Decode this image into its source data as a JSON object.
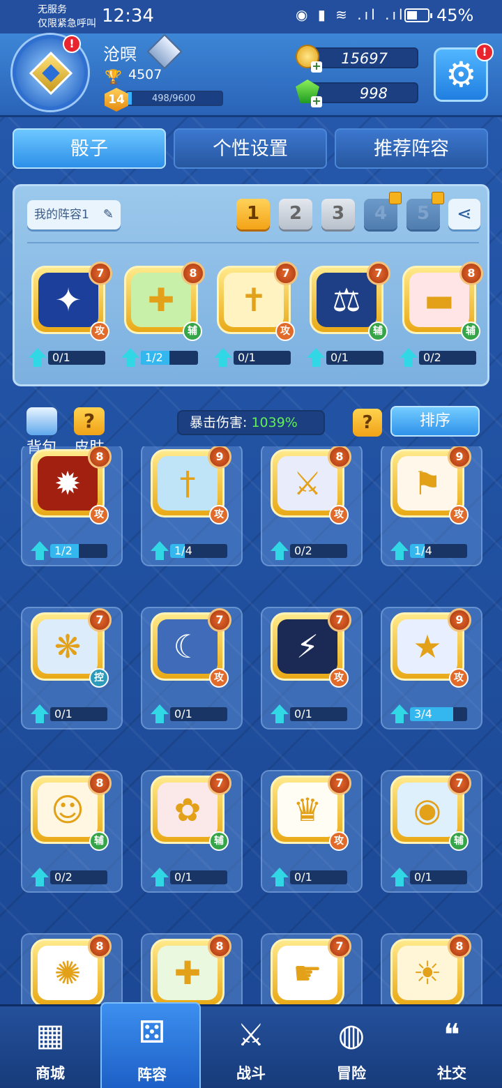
{
  "status_bar": {
    "carrier_line1": "无服务",
    "carrier_line2": "仅限紧急呼叫",
    "time": "12:34",
    "icons": "◉ ▮ ≋ .ıl .ıl",
    "battery": "45%"
  },
  "player": {
    "name": "沧暝",
    "trophies": "4507",
    "level": "14",
    "xp_text": "498/9600",
    "xp_progress": 0.052,
    "gold": "15697",
    "gems": "998"
  },
  "tabs": [
    {
      "label": "骰子",
      "active": true
    },
    {
      "label": "个性设置",
      "active": false
    },
    {
      "label": "推荐阵容",
      "active": false
    }
  ],
  "lineup": {
    "name": "我的阵容1",
    "edit_icon": "pencil-icon",
    "slots": [
      {
        "label": "1",
        "state": "on"
      },
      {
        "label": "2",
        "state": "off"
      },
      {
        "label": "3",
        "state": "off"
      },
      {
        "label": "4",
        "state": "lock"
      },
      {
        "label": "5",
        "state": "lock"
      }
    ],
    "share_icon": "share-icon",
    "dice": [
      {
        "level": "7",
        "role": "攻",
        "progress": "0/1",
        "fill": 0,
        "color": "#1b3f9a",
        "glyph": "✦"
      },
      {
        "level": "8",
        "role": "辅",
        "progress": "1/2",
        "fill": 0.5,
        "color": "#c9f0a8",
        "glyph": "✚"
      },
      {
        "level": "7",
        "role": "攻",
        "progress": "0/1",
        "fill": 0,
        "color": "#fff3c2",
        "glyph": "✝"
      },
      {
        "level": "7",
        "role": "辅",
        "progress": "0/1",
        "fill": 0,
        "color": "#1e3e86",
        "glyph": "⚖"
      },
      {
        "level": "8",
        "role": "辅",
        "progress": "0/2",
        "fill": 0,
        "color": "#ffe5e5",
        "glyph": "▬"
      }
    ]
  },
  "middle_bar": {
    "bag_label": "背包",
    "skin_label": "皮肤",
    "crit_label": "暴击伤害:",
    "crit_value": "1039%",
    "help_label": "?",
    "sort_label": "排序"
  },
  "collection": [
    {
      "level": "8",
      "role": "攻",
      "progress": "1/2",
      "fill": 0.5,
      "color": "#a22010",
      "glyph": "✹"
    },
    {
      "level": "9",
      "role": "攻",
      "progress": "1/4",
      "fill": 0.25,
      "color": "#bfe3f7",
      "glyph": "†"
    },
    {
      "level": "8",
      "role": "攻",
      "progress": "0/2",
      "fill": 0,
      "color": "#e9ecfb",
      "glyph": "⚔"
    },
    {
      "level": "9",
      "role": "攻",
      "progress": "1/4",
      "fill": 0.25,
      "color": "#fff7ea",
      "glyph": "⚑"
    },
    {
      "level": "7",
      "role": "控",
      "progress": "0/1",
      "fill": 0,
      "color": "#dcecfb",
      "glyph": "❋"
    },
    {
      "level": "7",
      "role": "攻",
      "progress": "0/1",
      "fill": 0,
      "color": "#3f6bb8",
      "glyph": "☾"
    },
    {
      "level": "7",
      "role": "攻",
      "progress": "0/1",
      "fill": 0,
      "color": "#1b2a55",
      "glyph": "⚡"
    },
    {
      "level": "9",
      "role": "攻",
      "progress": "3/4",
      "fill": 0.75,
      "color": "#e8f0ff",
      "glyph": "★"
    },
    {
      "level": "8",
      "role": "辅",
      "progress": "0/2",
      "fill": 0,
      "color": "#fff7e2",
      "glyph": "☺"
    },
    {
      "level": "7",
      "role": "辅",
      "progress": "0/1",
      "fill": 0,
      "color": "#fbe8e8",
      "glyph": "✿"
    },
    {
      "level": "7",
      "role": "攻",
      "progress": "0/1",
      "fill": 0,
      "color": "#fffdf4",
      "glyph": "♛"
    },
    {
      "level": "7",
      "role": "辅",
      "progress": "0/1",
      "fill": 0,
      "color": "#dff0fd",
      "glyph": "◉"
    },
    {
      "level": "8",
      "role": "",
      "progress": "",
      "fill": 0,
      "color": "#ffffff",
      "glyph": "✺"
    },
    {
      "level": "8",
      "role": "",
      "progress": "",
      "fill": 0,
      "color": "#eaf8e0",
      "glyph": "✚"
    },
    {
      "level": "7",
      "role": "",
      "progress": "",
      "fill": 0,
      "color": "#ffffff",
      "glyph": "☛"
    },
    {
      "level": "8",
      "role": "",
      "progress": "",
      "fill": 0,
      "color": "#fff6d8",
      "glyph": "☀"
    }
  ],
  "nav": [
    {
      "label": "商城",
      "icon": "shop-icon",
      "glyph": "▦",
      "active": false
    },
    {
      "label": "阵容",
      "icon": "dice-icon",
      "glyph": "⚄",
      "active": true
    },
    {
      "label": "战斗",
      "icon": "crossed-swords-icon",
      "glyph": "⚔",
      "active": false
    },
    {
      "label": "冒险",
      "icon": "planet-icon",
      "glyph": "◍",
      "active": false
    },
    {
      "label": "社交",
      "icon": "chat-icon",
      "glyph": "❝",
      "active": false
    }
  ],
  "colors": {
    "gold": "#f3a317",
    "accent_blue": "#2d8fe8",
    "crit_green": "#62f05a",
    "attack_badge": "#e06b2a",
    "support_badge": "#36a54a",
    "control_badge": "#2c9ab8"
  }
}
